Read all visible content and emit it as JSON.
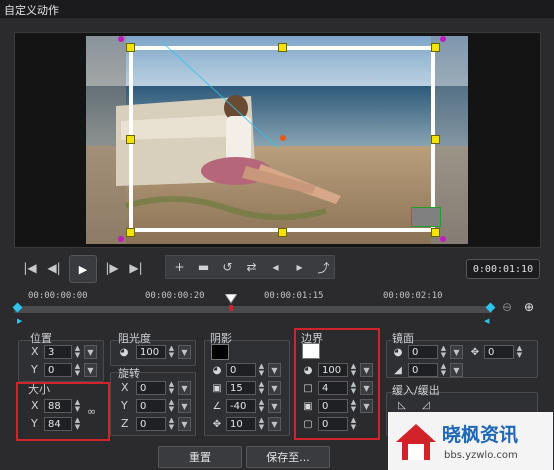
{
  "window": {
    "title": "自定义动作"
  },
  "transport": {
    "timecode": "0:00:01:10"
  },
  "timeline": {
    "ticks": [
      "00:00:00:00",
      "00:00:00:20",
      "00:00:01:15",
      "00:00:02:10"
    ]
  },
  "position": {
    "title": "位置",
    "x_label": "X",
    "x": "3",
    "y_label": "Y",
    "y": "0"
  },
  "size": {
    "title": "大小",
    "x_label": "X",
    "x": "88",
    "y_label": "Y",
    "y": "84"
  },
  "opacity": {
    "title": "阻光度",
    "value": "100"
  },
  "rotation": {
    "title": "旋转",
    "x_label": "X",
    "x": "0",
    "y_label": "Y",
    "y": "0",
    "z_label": "Z",
    "z": "0"
  },
  "shadow": {
    "title": "阴影",
    "color": "#000000",
    "v1": "0",
    "v2": "15",
    "v3": "-40",
    "v4": "10"
  },
  "border": {
    "title": "边界",
    "color": "#ffffff",
    "v1": "100",
    "v2": "4",
    "v3": "0",
    "v4": "0"
  },
  "mirror": {
    "title": "镜面",
    "v1": "0",
    "v2": "0",
    "v3": "0"
  },
  "easing": {
    "title": "缓入/缓出"
  },
  "footer": {
    "reset": "重置",
    "save_as": "保存至..."
  },
  "watermark": {
    "brand": "晓枫资讯",
    "url": "bbs.yzwlo.com"
  },
  "colors": {
    "accent_red": "#d2232a",
    "handle_yellow": "#f2e300",
    "corner_magenta": "#c01dc0",
    "playhead_red": "#d2232a",
    "keyframe_cyan": "#2ec4ec"
  }
}
